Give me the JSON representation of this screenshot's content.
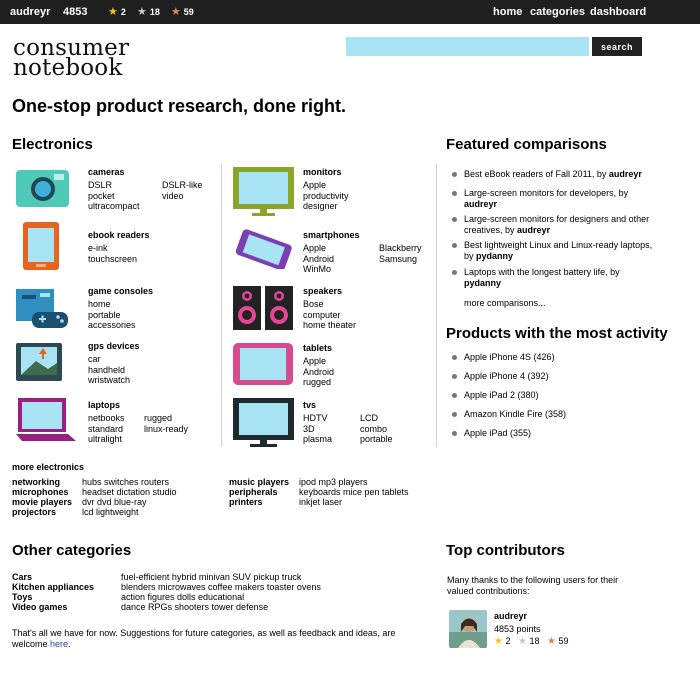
{
  "user": {
    "name": "audreyr",
    "points": "4853",
    "gold": "2",
    "silver": "18",
    "bronze": "59"
  },
  "nav": {
    "home": "home",
    "categories": "categories",
    "dashboard": "dashboard"
  },
  "logo": {
    "line1": "consumer",
    "line2": "notebook"
  },
  "search": {
    "placeholder": "",
    "button": "search"
  },
  "headline": "One-stop product research, done right.",
  "electronics": {
    "title": "Electronics",
    "items": [
      {
        "title": "cameras",
        "col1": [
          "DSLR",
          "pocket",
          "ultracompact"
        ],
        "col2": [
          "DSLR-like",
          "video"
        ],
        "icon": "camera-icon"
      },
      {
        "title": "monitors",
        "col1": [
          "Apple",
          "productivity",
          "designer"
        ],
        "col2": [],
        "icon": "monitor-icon"
      },
      {
        "title": "ebook readers",
        "col1": [
          "e-ink",
          "touchscreen"
        ],
        "col2": [],
        "icon": "ebook-reader-icon"
      },
      {
        "title": "smartphones",
        "col1": [
          "Apple",
          "Android",
          "WinMo"
        ],
        "col2": [
          "Blackberry",
          "Samsung"
        ],
        "icon": "smartphone-icon"
      },
      {
        "title": "game consoles",
        "col1": [
          "home",
          "portable",
          "accessories"
        ],
        "col2": [],
        "icon": "game-console-icon"
      },
      {
        "title": "speakers",
        "col1": [
          "Bose",
          "computer",
          "home theater"
        ],
        "col2": [],
        "icon": "speakers-icon"
      },
      {
        "title": "gps devices",
        "col1": [
          "car",
          "handheld",
          "wristwatch"
        ],
        "col2": [],
        "icon": "gps-icon"
      },
      {
        "title": "tablets",
        "col1": [
          "Apple",
          "Android",
          "rugged"
        ],
        "col2": [],
        "icon": "tablet-icon"
      },
      {
        "title": "laptops",
        "col1": [
          "netbooks",
          "standard",
          "ultralight"
        ],
        "col2": [
          "rugged",
          "linux-ready"
        ],
        "icon": "laptop-icon"
      },
      {
        "title": "tvs",
        "col1": [
          "HDTV",
          "3D",
          "plasma"
        ],
        "col2": [
          "LCD",
          "combo",
          "portable"
        ],
        "icon": "tv-icon"
      }
    ],
    "more_title": "more electronics",
    "more_left": [
      {
        "label": "networking",
        "value": "hubs  switches  routers"
      },
      {
        "label": "microphones",
        "value": "headset  dictation  studio"
      },
      {
        "label": "movie players",
        "value": "dvr  dvd  blue-ray"
      },
      {
        "label": "projectors",
        "value": "lcd  lightweight"
      }
    ],
    "more_right": [
      {
        "label": "music players",
        "value": "ipod  mp3 players"
      },
      {
        "label": "peripherals",
        "value": "keyboards  mice  pen tablets"
      },
      {
        "label": "printers",
        "value": "inkjet  laser"
      }
    ]
  },
  "featured": {
    "title": "Featured comparisons",
    "items": [
      {
        "text": "Best eBook readers of Fall 2011, by ",
        "author": "audreyr"
      },
      {
        "text": "Large-screen monitors for developers, by ",
        "author": "audreyr"
      },
      {
        "text": "Large-screen monitors for designers and other creatives, by ",
        "author": "audreyr"
      },
      {
        "text": "Best lightweight Linux and Linux-ready laptops, by ",
        "author": "pydanny"
      },
      {
        "text": "Laptops with the longest battery life, by ",
        "author": "pydanny"
      }
    ],
    "more": "more comparisons..."
  },
  "activity": {
    "title": "Products with the most activity",
    "items": [
      "Apple iPhone 4S (426)",
      "Apple iPhone 4 (392)",
      "Apple iPad 2 (380)",
      "Amazon Kindle Fire (358)",
      "Apple iPad (355)"
    ]
  },
  "other": {
    "title": "Other categories",
    "rows": [
      {
        "label": "Cars",
        "value": "fuel-efficient  hybrid  minivan  SUV  pickup truck"
      },
      {
        "label": "Kitchen appliances",
        "value": "blenders  microwaves  coffee makers  toaster ovens"
      },
      {
        "label": "Toys",
        "value": "action figures  dolls  educational"
      },
      {
        "label": "Video games",
        "value": "dance  RPGs  shooters  tower defense"
      }
    ],
    "note": "That's all we have for now.   Suggestions for future categories, as well as feedback and ideas, are welcome ",
    "note_link": "here",
    "note_end": "."
  },
  "contributors": {
    "title": "Top contributors",
    "intro": "Many thanks to the following users for their valued contributions:",
    "top": {
      "name": "audreyr",
      "points": "4853 points",
      "gold": "2",
      "silver": "18",
      "bronze": "59"
    }
  },
  "colors": {
    "bar": "#1f1f1f",
    "search": "#a8e4f4",
    "accent_teal": "#4fc9b8",
    "accent_orange": "#e8651f",
    "accent_olive": "#8aa52a",
    "accent_purple": "#7b3fb5",
    "accent_pink": "#d94a8c",
    "accent_magenta": "#9b1f7f"
  }
}
